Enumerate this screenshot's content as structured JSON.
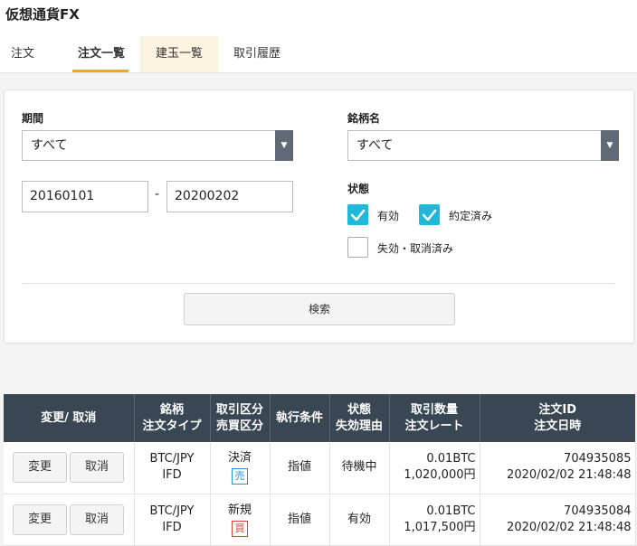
{
  "app": {
    "title": "仮想通貨FX"
  },
  "tabs": [
    {
      "label": "注文"
    },
    {
      "label": "注文一覧"
    },
    {
      "label": "建玉一覧"
    },
    {
      "label": "取引履歴"
    }
  ],
  "filters": {
    "period_label": "期間",
    "period_select": "すべて",
    "date_from": "20160101",
    "date_sep": "-",
    "date_to": "20200202",
    "symbol_label": "銘柄名",
    "symbol_select": "すべて",
    "status_label": "状態",
    "status_options": [
      {
        "label": "有効",
        "checked": true
      },
      {
        "label": "約定済み",
        "checked": true
      },
      {
        "label": "失効・取消済み",
        "checked": false
      }
    ],
    "search_label": "検索"
  },
  "colors": {
    "accent": "#f5a623",
    "checkbox": "#1fb8d8",
    "header_bg": "#394653",
    "sell": "#2a8fd6",
    "buy": "#d9453a"
  },
  "table": {
    "headers": [
      {
        "line1": "変更/ 取消",
        "line2": ""
      },
      {
        "line1": "銘柄",
        "line2": "注文タイプ"
      },
      {
        "line1": "取引区分",
        "line2": "売買区分"
      },
      {
        "line1": "執行条件",
        "line2": ""
      },
      {
        "line1": "状態",
        "line2": "失効理由"
      },
      {
        "line1": "取引数量",
        "line2": "注文レート"
      },
      {
        "line1": "注文ID",
        "line2": "注文日時"
      }
    ],
    "rows": [
      {
        "edit": "変更",
        "cancel": "取消",
        "symbol": "BTC/JPY",
        "order_type": "IFD",
        "trade_class": "決済",
        "side": "売",
        "exec": "指値",
        "status": "待機中",
        "qty": "0.01BTC",
        "rate": "1,020,000円",
        "order_id": "704935085",
        "datetime": "2020/02/02 21:48:48"
      },
      {
        "edit": "変更",
        "cancel": "取消",
        "symbol": "BTC/JPY",
        "order_type": "IFD",
        "trade_class": "新規",
        "side": "買",
        "exec": "指値",
        "status": "有効",
        "qty": "0.01BTC",
        "rate": "1,017,500円",
        "order_id": "704935084",
        "datetime": "2020/02/02 21:48:48"
      }
    ]
  }
}
